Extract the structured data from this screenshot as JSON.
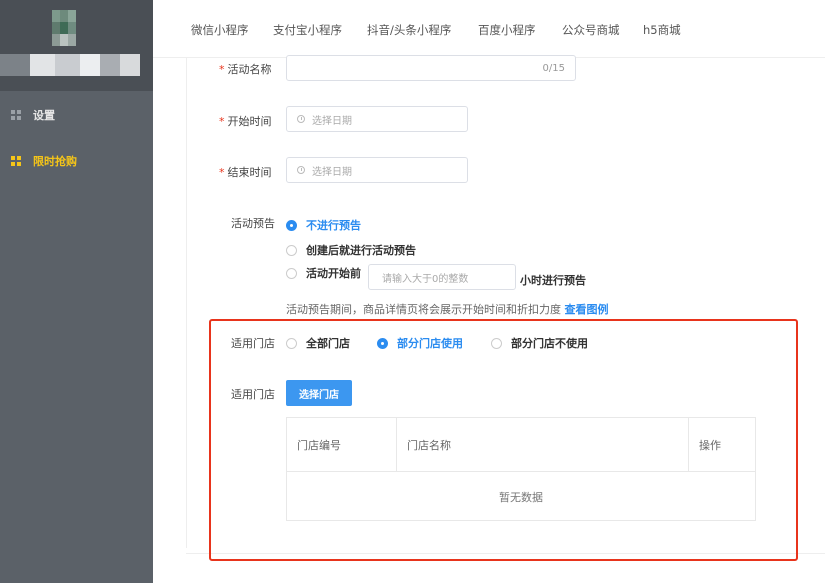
{
  "sidebar": {
    "items": [
      {
        "label": "设置",
        "icon": "grid-icon",
        "active": false
      },
      {
        "label": "限时抢购",
        "icon": "grid-icon",
        "active": true
      }
    ],
    "active_color": "#f5c518"
  },
  "tabs": [
    "微信小程序",
    "支付宝小程序",
    "抖音/头条小程序",
    "百度小程序",
    "公众号商城",
    "h5商城"
  ],
  "form": {
    "name": {
      "label": "活动名称",
      "required": true,
      "value": "",
      "counter": "0/15"
    },
    "start_time": {
      "label": "开始时间",
      "required": true,
      "placeholder": "选择日期",
      "icon": "clock-icon"
    },
    "end_time": {
      "label": "结束时间",
      "required": true,
      "placeholder": "选择日期",
      "icon": "clock-icon"
    },
    "preview": {
      "label": "活动预告",
      "options": [
        "不进行预告",
        "创建后就进行活动预告",
        "活动开始前"
      ],
      "selected_index": 0,
      "hours_placeholder": "请输入大于0的整数",
      "hours_suffix": "小时进行预告",
      "hint": "活动预告期间，商品详情页将会展示开始时间和折扣力度",
      "hint_link": "查看图例"
    },
    "stores": {
      "label": "适用门店",
      "options": [
        "全部门店",
        "部分门店使用",
        "部分门店不使用"
      ],
      "selected_index": 1,
      "select_label": "适用门店",
      "select_button": "选择门店",
      "table": {
        "columns": [
          "门店编号",
          "门店名称",
          "操作"
        ],
        "empty_text": "暂无数据"
      }
    }
  },
  "colors": {
    "accent": "#2b8cf0",
    "required": "#e8341c",
    "highlight_frame": "#e8341c",
    "button": "#3c97f0"
  }
}
